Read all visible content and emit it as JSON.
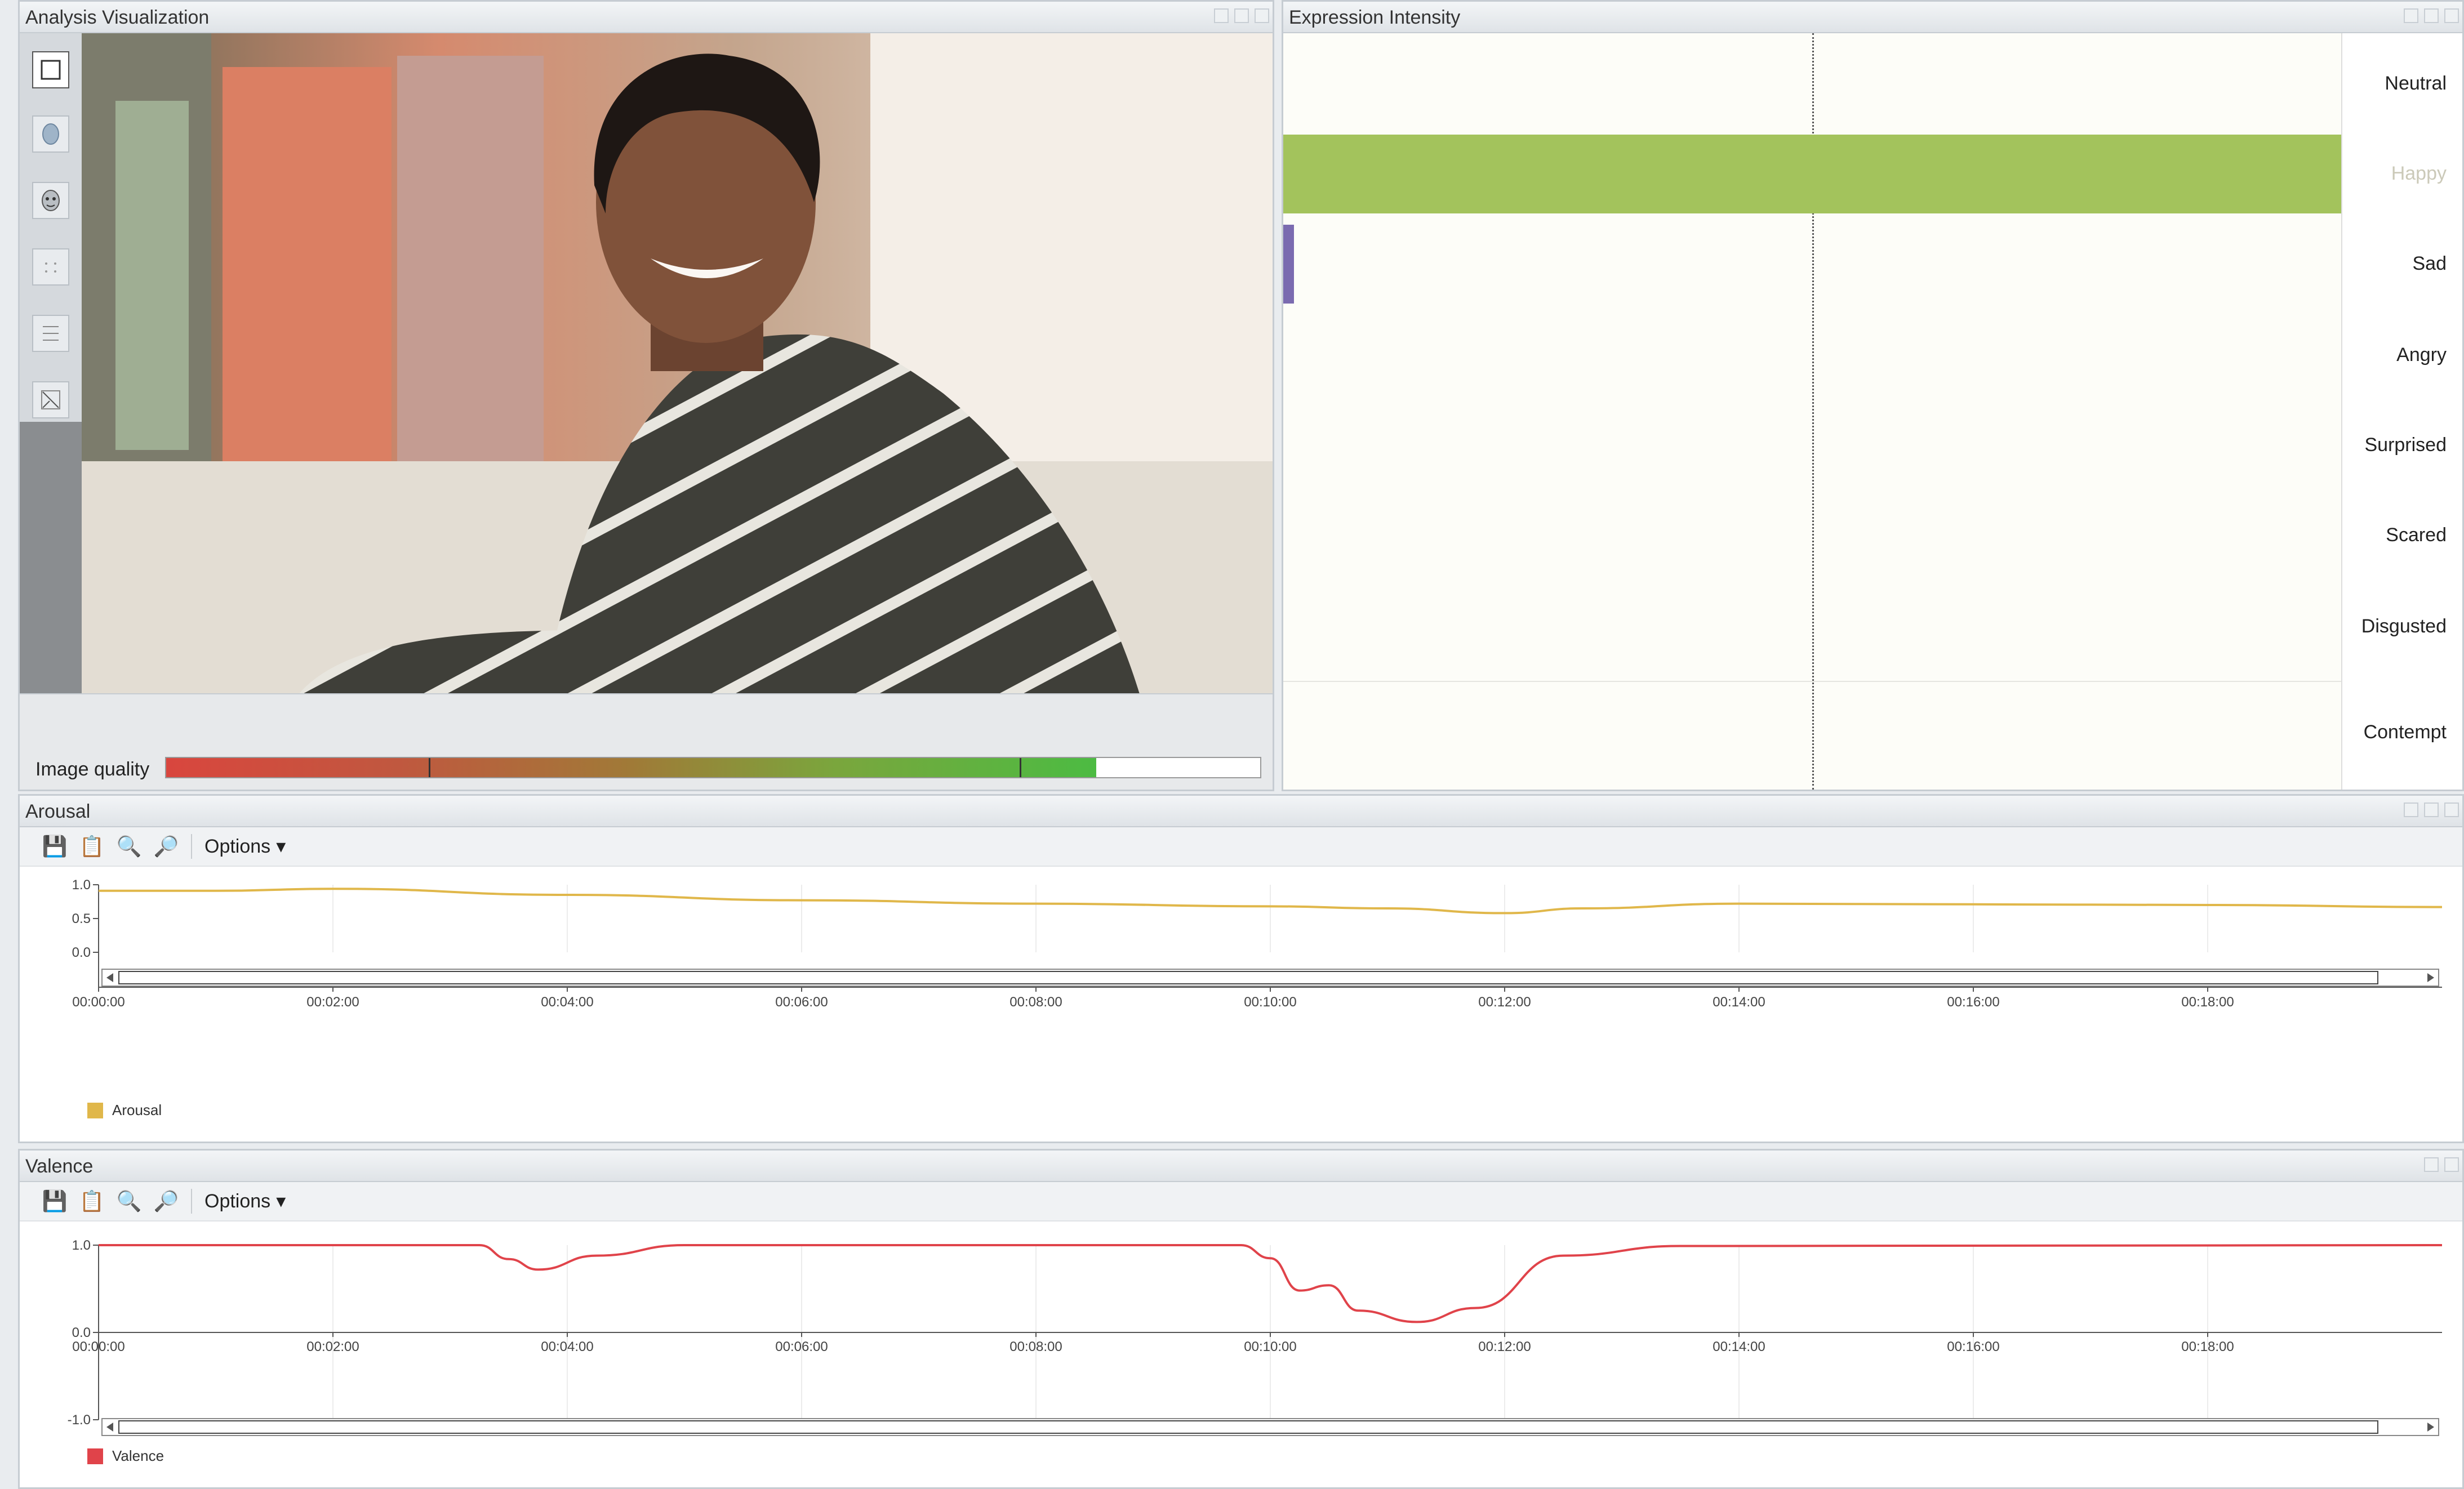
{
  "analysis": {
    "title": "Analysis Visualization",
    "image_quality_label": "Image quality",
    "image_quality": 0.85,
    "tools": [
      "select-tool-icon",
      "face-mesh-icon",
      "face-model-icon",
      "grid-icon",
      "landmark-icon",
      "overlay-icon"
    ]
  },
  "expression": {
    "title": "Expression Intensity",
    "labels": [
      "Neutral",
      "Happy",
      "Sad",
      "Angry",
      "Surprised",
      "Scared",
      "Disgusted",
      "Contempt"
    ],
    "happy_intensity": 1.0,
    "sad_intensity": 0.01,
    "colors": {
      "happy": "#a3c35c",
      "sad": "#7b6bb0"
    }
  },
  "arousal": {
    "title": "Arousal",
    "options_label": "Options",
    "legend": "Arousal",
    "color": "#e0b74a",
    "chart_data": {
      "type": "line",
      "series": [
        {
          "name": "Arousal",
          "x": [
            "00:00:00",
            "00:01:00",
            "00:02:00",
            "00:04:00",
            "00:06:00",
            "00:08:00",
            "00:10:00",
            "00:11:00",
            "00:12:00",
            "00:12:40",
            "00:14:00",
            "00:16:00",
            "00:18:00",
            "00:20:00"
          ],
          "values": [
            0.91,
            0.91,
            0.94,
            0.85,
            0.77,
            0.72,
            0.68,
            0.65,
            0.58,
            0.65,
            0.72,
            0.71,
            0.7,
            0.67
          ]
        }
      ],
      "yticks": [
        "1.0",
        "0.5",
        "0.0"
      ],
      "ylim": [
        0,
        1
      ],
      "xticks": [
        "00:00:00",
        "00:02:00",
        "00:04:00",
        "00:06:00",
        "00:08:00",
        "00:10:00",
        "00:12:00",
        "00:14:00",
        "00:16:00",
        "00:18:00"
      ]
    }
  },
  "valence": {
    "title": "Valence",
    "options_label": "Options",
    "legend": "Valence",
    "color": "#e0434a",
    "chart_data": {
      "type": "line",
      "series": [
        {
          "name": "Valence",
          "x": [
            "00:00:00",
            "00:03:15",
            "00:03:30",
            "00:03:45",
            "00:04:15",
            "00:05:00",
            "00:09:45",
            "00:10:00",
            "00:10:15",
            "00:10:30",
            "00:10:45",
            "00:11:15",
            "00:11:45",
            "00:12:30",
            "00:13:30",
            "00:20:00"
          ],
          "values": [
            1.0,
            1.0,
            0.84,
            0.72,
            0.88,
            1.0,
            1.0,
            0.85,
            0.48,
            0.54,
            0.25,
            0.12,
            0.28,
            0.88,
            0.99,
            1.0
          ]
        }
      ],
      "yticks": [
        "1.0",
        "0.0",
        "-1.0"
      ],
      "ylim": [
        -1,
        1
      ],
      "xticks": [
        "00:00:00",
        "00:02:00",
        "00:04:00",
        "00:06:00",
        "00:08:00",
        "00:10:00",
        "00:12:00",
        "00:14:00",
        "00:16:00",
        "00:18:00"
      ]
    }
  }
}
